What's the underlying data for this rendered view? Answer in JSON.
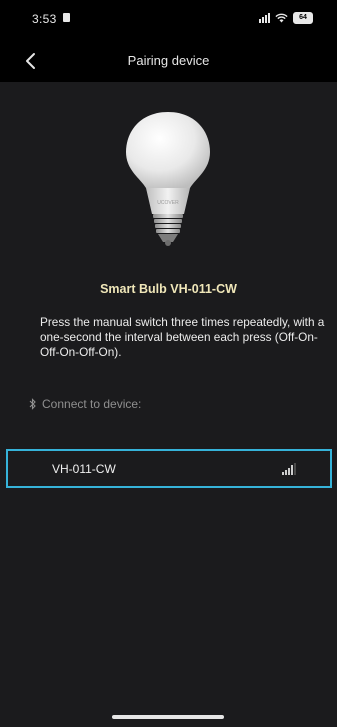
{
  "status_bar": {
    "time": "3:53",
    "battery": "64"
  },
  "nav": {
    "title": "Pairing device"
  },
  "product": {
    "name": "Smart Bulb VH-011-CW",
    "brand_mark": "UCOVER"
  },
  "instructions": "Press the manual switch three times repeatedly, with a one-second the interval between each press (Off-On-Off-On-Off-On).",
  "connect": {
    "label": "Connect to device:"
  },
  "devices": [
    {
      "name": "VH-011-CW",
      "signal_level": 3
    }
  ],
  "colors": {
    "accent_border": "#36b3d9",
    "product_name": "#efe6b8",
    "background": "#1b1b1d"
  },
  "icons": {
    "back": "chevron-left-icon",
    "bluetooth": "bluetooth-icon",
    "signal": "signal-strength-icon"
  }
}
